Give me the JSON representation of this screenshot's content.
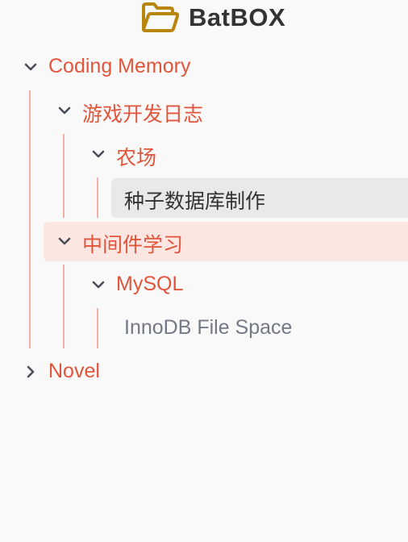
{
  "header": {
    "title": "BatBOX",
    "logo_icon": "folder-open-icon",
    "logo_color": "#b8860b"
  },
  "tree": {
    "accent_color": "#e2553b",
    "guide_color": "#f3b0a4",
    "nodes": [
      {
        "label": "Coding Memory",
        "expanded": true,
        "icon": "chevron-down-icon"
      },
      {
        "label": "游戏开发日志",
        "expanded": true,
        "icon": "chevron-down-icon"
      },
      {
        "label": "农场",
        "expanded": true,
        "icon": "chevron-down-icon"
      },
      {
        "label": "种子数据库制作",
        "selected": true
      },
      {
        "label": "中间件学习",
        "expanded": true,
        "icon": "chevron-down-icon",
        "highlighted": true
      },
      {
        "label": "MySQL",
        "expanded": true,
        "icon": "chevron-down-icon"
      },
      {
        "label": "InnoDB File Space"
      },
      {
        "label": "Novel",
        "expanded": false,
        "icon": "chevron-right-icon"
      }
    ]
  }
}
